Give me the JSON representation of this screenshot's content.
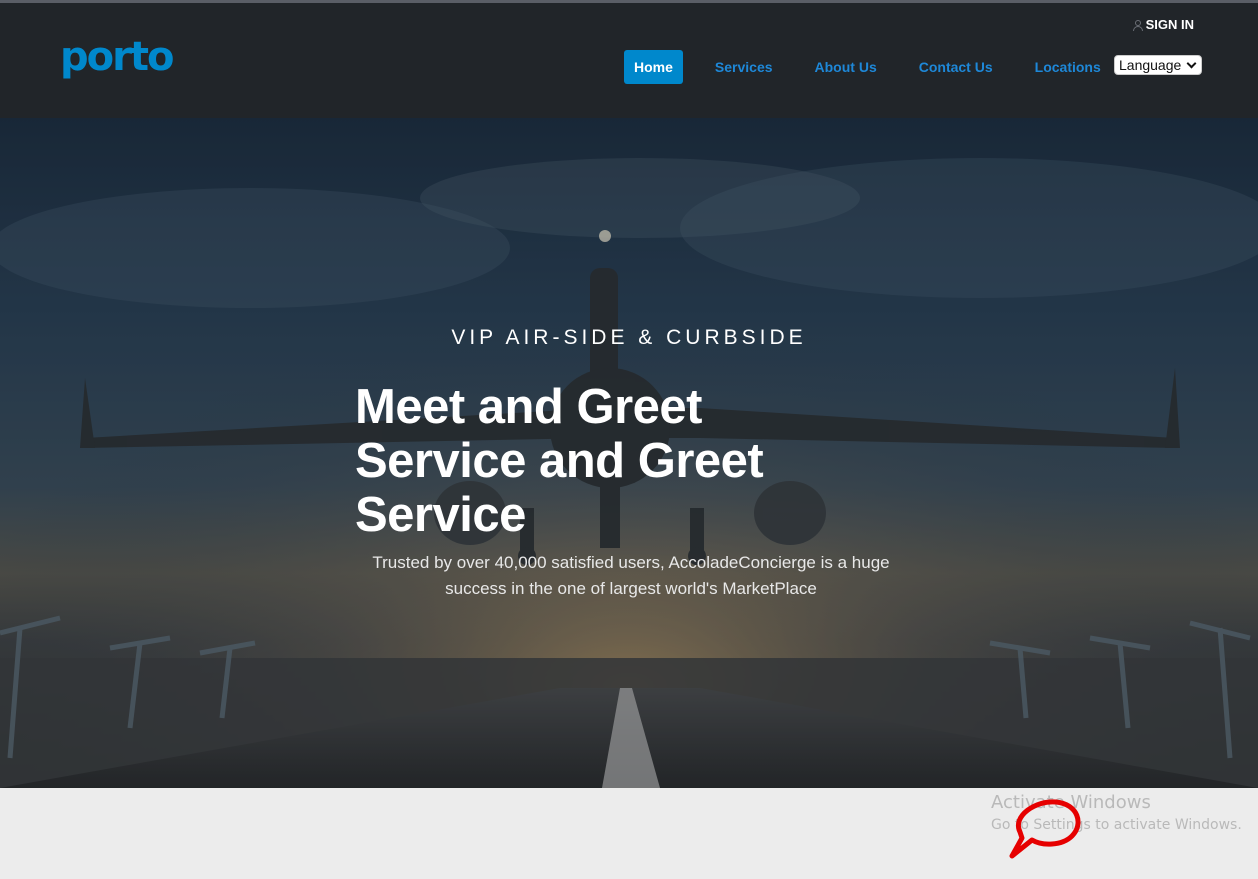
{
  "navbar": {
    "logo_text": "porto",
    "signin_label": "SIGN IN",
    "menu": [
      {
        "label": "Home",
        "active": true
      },
      {
        "label": "Services",
        "active": false
      },
      {
        "label": "About Us",
        "active": false
      },
      {
        "label": "Contact Us",
        "active": false
      },
      {
        "label": "Locations",
        "active": false
      }
    ],
    "language_select": "Language"
  },
  "hero": {
    "eyebrow": "VIP AIR-SIDE & CURBSIDE",
    "headline": "Meet and Greet Service and Greet Service",
    "subtext_line1": "Trusted by over 40,000 satisfied users, AccoladeConcierge is a huge",
    "subtext_line2": "success in the one of largest world's MarketPlace"
  },
  "os_watermark": {
    "title": "Activate Windows",
    "subtitle": "Go to Settings to activate Windows."
  },
  "colors": {
    "navbar_bg": "#212529",
    "brand": "#0088cc",
    "nav_link": "#1e88d8",
    "chat_icon": "#e60000"
  },
  "icons": {
    "signin": "user-icon",
    "language": "chevron-down-icon",
    "chat": "chat-bubble-icon"
  }
}
